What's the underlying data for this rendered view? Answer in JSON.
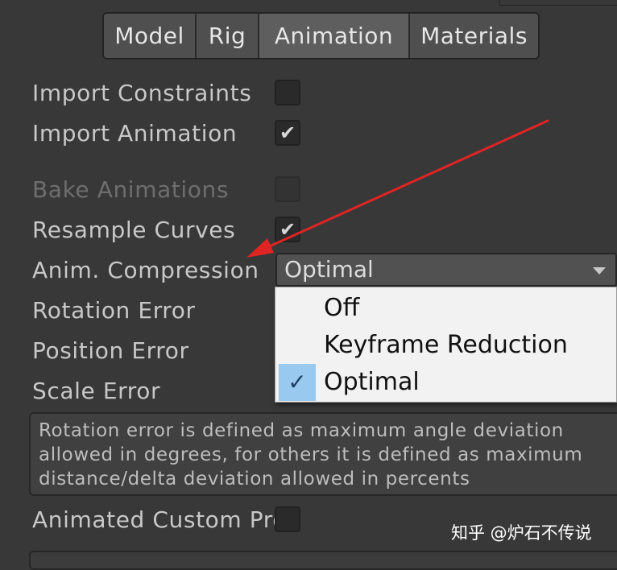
{
  "tabs": [
    {
      "label": "Model"
    },
    {
      "label": "Rig"
    },
    {
      "label": "Animation"
    },
    {
      "label": "Materials"
    }
  ],
  "rows": {
    "import_constraints": "Import Constraints",
    "import_animation": "Import Animation",
    "bake_animations": "Bake Animations",
    "resample_curves": "Resample Curves",
    "anim_compression": "Anim. Compression",
    "rotation_error": "Rotation Error",
    "position_error": "Position Error",
    "scale_error": "Scale Error",
    "animated_custom_props": "Animated Custom Pro"
  },
  "checkboxes": {
    "import_constraints": false,
    "import_animation": true,
    "bake_animations": false,
    "resample_curves": true,
    "animated_custom_props": false
  },
  "dropdown": {
    "selected": "Optimal",
    "options": [
      "Off",
      "Keyframe Reduction",
      "Optimal"
    ]
  },
  "help_text": "Rotation error is defined as maximum angle deviation allowed in degrees, for others it is defined as maximum distance/delta deviation allowed in percents",
  "watermark": "知乎 @炉石不传说",
  "icons": {
    "check": "✓",
    "checkbox_tick": "✔"
  },
  "colors": {
    "background": "#383838",
    "annotation_arrow": "#e02424",
    "popup_highlight": "#99c9ef"
  }
}
